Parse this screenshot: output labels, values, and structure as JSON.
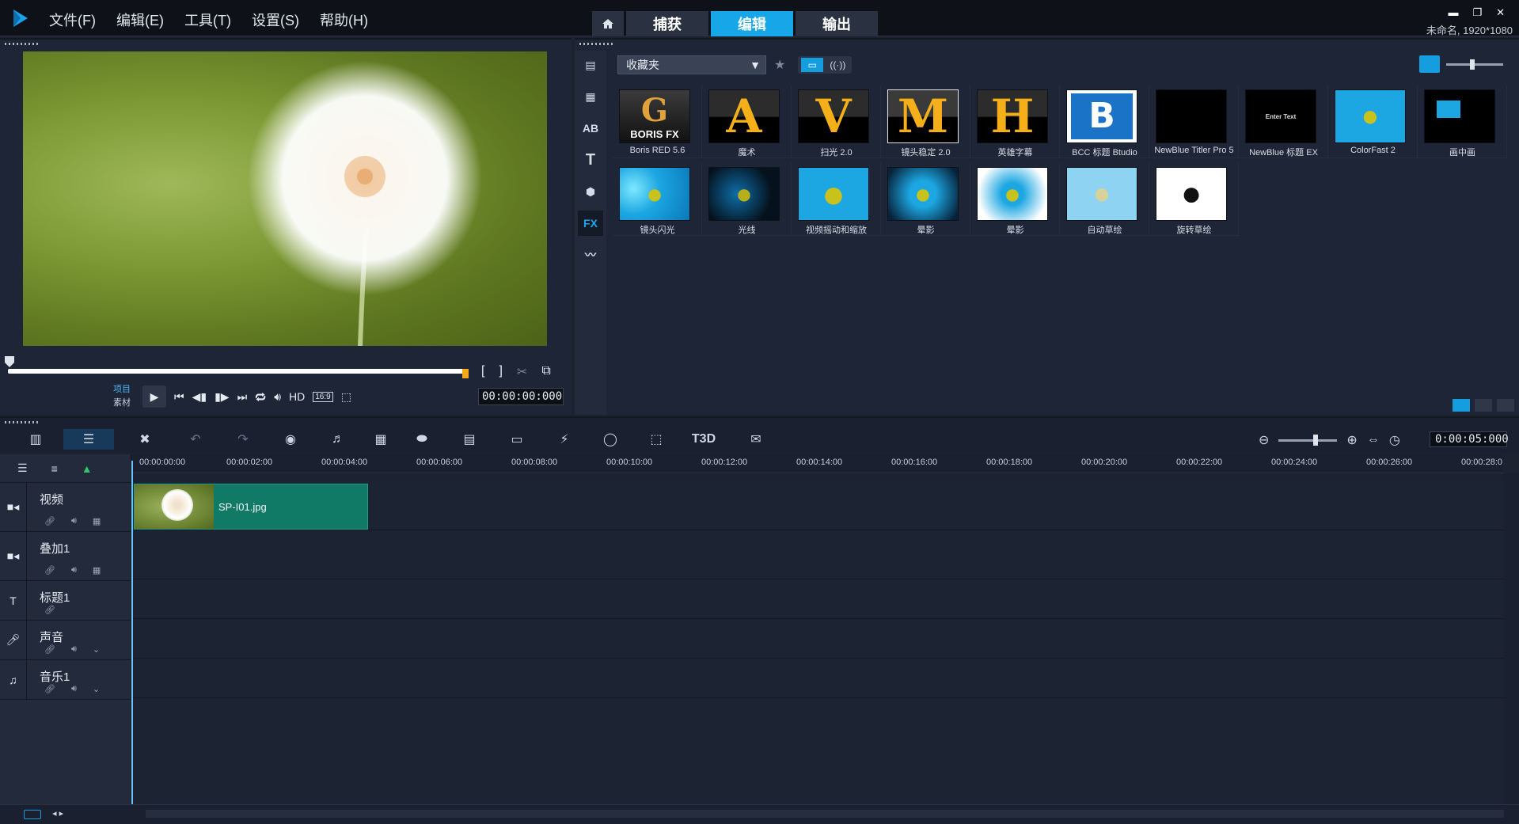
{
  "menu": {
    "items": [
      "文件(F)",
      "编辑(E)",
      "工具(T)",
      "设置(S)",
      "帮助(H)"
    ]
  },
  "main_tabs": [
    "捕获",
    "编辑",
    "输出"
  ],
  "window": {
    "project_info": "未命名, 1920*1080"
  },
  "player": {
    "project_label": "项目",
    "clip_label": "素材",
    "hd_label": "HD",
    "aspect_label": "16:9",
    "timecode": "00:00:00:000",
    "mark_in": "[",
    "mark_out": "]"
  },
  "library": {
    "folder": "收藏夹",
    "items": [
      {
        "label": "Boris RED 5.6",
        "thumb": "BORIS FX"
      },
      {
        "label": "魔术",
        "thumb": "A"
      },
      {
        "label": "扫光 2.0",
        "thumb": "V"
      },
      {
        "label": "镜头稳定 2.0",
        "thumb": "M"
      },
      {
        "label": "英雄字幕",
        "thumb": "H"
      },
      {
        "label": "BCC 标题 Btudio",
        "thumb": "B"
      },
      {
        "label": "NewBlue Titler Pro 5",
        "thumb": ""
      },
      {
        "label": "NewBlue 标题 EX",
        "thumb": "Enter Text"
      },
      {
        "label": "ColorFast 2",
        "thumb": ""
      },
      {
        "label": "画中画",
        "thumb": ""
      },
      {
        "label": "镜头闪光",
        "thumb": ""
      },
      {
        "label": "光线",
        "thumb": ""
      },
      {
        "label": "视频摇动和缩放",
        "thumb": ""
      },
      {
        "label": "晕影",
        "thumb": ""
      },
      {
        "label": "晕影",
        "thumb": ""
      },
      {
        "label": "自动草绘",
        "thumb": ""
      },
      {
        "label": "旋转草绘",
        "thumb": ""
      }
    ]
  },
  "timeline": {
    "total_time": "0:00:05:000",
    "ruler": [
      "00:00:00:00",
      "00:00:02:00",
      "00:00:04:00",
      "00:00:06:00",
      "00:00:08:00",
      "00:00:10:00",
      "00:00:12:00",
      "00:00:14:00",
      "00:00:16:00",
      "00:00:18:00",
      "00:00:20:00",
      "00:00:22:00",
      "00:00:24:00",
      "00:00:26:00",
      "00:00:28:0"
    ],
    "tracks": [
      {
        "name": "视频",
        "icon": "video-track-icon"
      },
      {
        "name": "叠加1",
        "icon": "overlay-track-icon"
      },
      {
        "name": "标题1",
        "icon": "title-track-icon"
      },
      {
        "name": "声音",
        "icon": "voice-track-icon"
      },
      {
        "name": "音乐1",
        "icon": "music-track-icon"
      }
    ],
    "clip": {
      "name": "SP-I01.jpg"
    }
  },
  "colors": {
    "accent": "#17a7e8",
    "clip": "#117a66",
    "panel": "#1e2536"
  }
}
